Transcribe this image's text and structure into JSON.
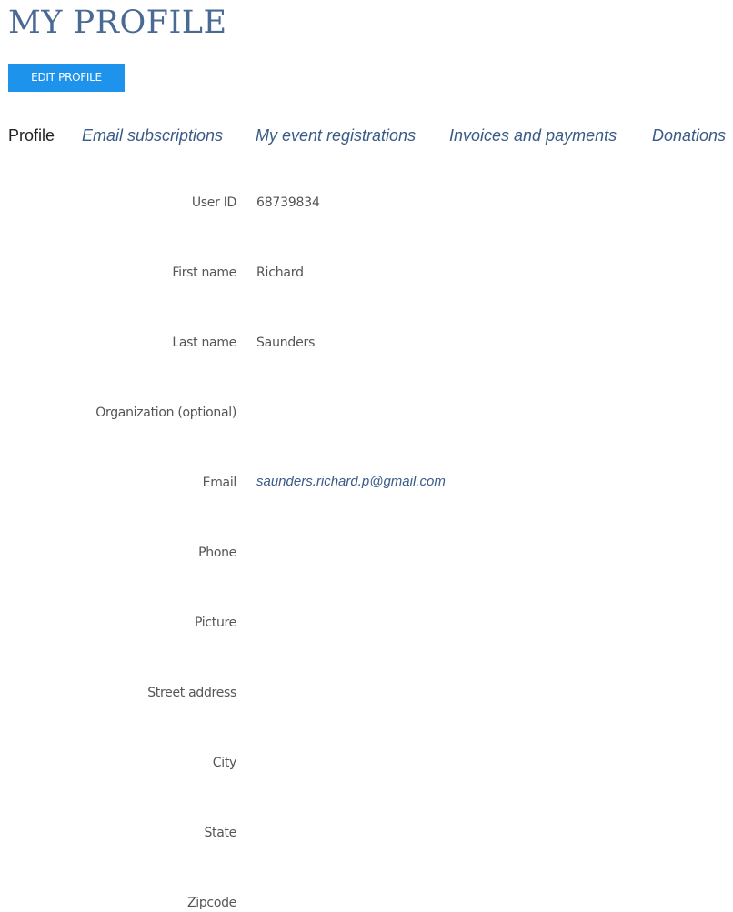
{
  "page": {
    "title": "MY PROFILE",
    "edit_button_label": "EDIT PROFILE"
  },
  "tabs": [
    {
      "label": "Profile",
      "active": true
    },
    {
      "label": "Email subscriptions",
      "active": false
    },
    {
      "label": "My event registrations",
      "active": false
    },
    {
      "label": "Invoices and payments",
      "active": false
    },
    {
      "label": "Donations",
      "active": false
    }
  ],
  "fields": [
    {
      "label": "User ID",
      "value": "68739834"
    },
    {
      "label": "First name",
      "value": "Richard"
    },
    {
      "label": "Last name",
      "value": "Saunders"
    },
    {
      "label": "Organization (optional)",
      "value": ""
    },
    {
      "label": "Email",
      "value": "saunders.richard.p@gmail.com"
    },
    {
      "label": "Phone",
      "value": ""
    },
    {
      "label": "Picture",
      "value": ""
    },
    {
      "label": "Street address",
      "value": ""
    },
    {
      "label": "City",
      "value": ""
    },
    {
      "label": "State",
      "value": ""
    },
    {
      "label": "Zipcode",
      "value": ""
    }
  ],
  "colors": {
    "title": "#4a6a94",
    "button_bg": "#1e93ec",
    "button_text": "#ffffff",
    "link": "#3a5a87",
    "active_tab": "#222222",
    "label_text": "#555555"
  }
}
